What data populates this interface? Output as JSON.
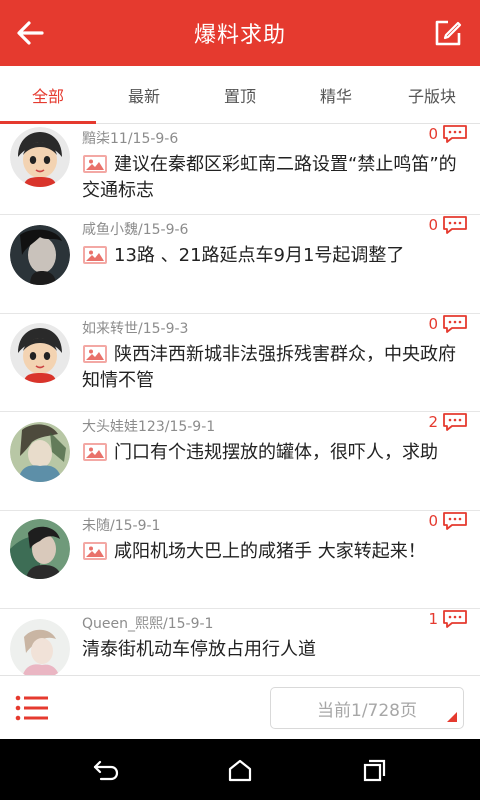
{
  "header": {
    "title": "爆料求助",
    "back_icon": "back-arrow-icon",
    "edit_icon": "compose-icon"
  },
  "tabs": [
    {
      "label": "全部",
      "active": true
    },
    {
      "label": "最新"
    },
    {
      "label": "置顶"
    },
    {
      "label": "精华"
    },
    {
      "label": "子版块"
    }
  ],
  "posts": [
    {
      "meta": "黯柒11/15-9-6",
      "replies": "0",
      "title": "建议在秦都区彩虹南二路设置“禁止鸣笛”的交通标志",
      "has_image": true,
      "avatar": "default-cartoon-avatar"
    },
    {
      "meta": "咸鱼小魏/15-9-6",
      "replies": "0",
      "title": "13路 、21路延点车9月1号起调整了",
      "has_image": true,
      "avatar": "user-photo-avatar"
    },
    {
      "meta": "如来转世/15-9-3",
      "replies": "0",
      "title": "陕西沣西新城非法强拆残害群众，中央政府知情不管",
      "has_image": true,
      "avatar": "default-cartoon-avatar"
    },
    {
      "meta": "大头娃娃123/15-9-1",
      "replies": "2",
      "title": "门口有个违规摆放的罐体，很吓人，求助",
      "has_image": true,
      "avatar": "user-photo-avatar"
    },
    {
      "meta": "未随/15-9-1",
      "replies": "0",
      "title": "咸阳机场大巴上的咸猪手 大家转起来！",
      "has_image": true,
      "avatar": "user-photo-avatar"
    },
    {
      "meta": "Queen_熙熙/15-9-1",
      "replies": "1",
      "title": "清泰街机动车停放占用行人道",
      "has_image": false,
      "avatar": "user-photo-avatar"
    }
  ],
  "bottom": {
    "page_label": "当前1/728页",
    "menu_icon": "list-menu-icon"
  },
  "system_nav": [
    "back-icon",
    "home-icon",
    "recent-apps-icon"
  ],
  "colors": {
    "accent": "#e53a2f",
    "meta_text": "#8c8c8c",
    "title_text": "#222222"
  }
}
